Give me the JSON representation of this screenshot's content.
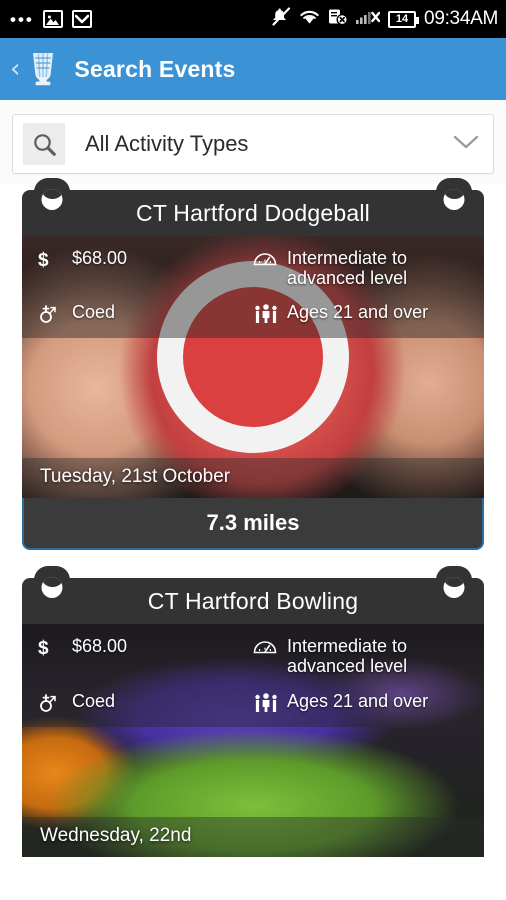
{
  "status_bar": {
    "left_icons": [
      "more-dots-icon",
      "photo-icon",
      "email-icon"
    ],
    "right_icons": [
      "mute-icon",
      "wifi-icon",
      "sim-off-icon",
      "signal-off-icon"
    ],
    "battery_level": "14",
    "time": "09:34AM"
  },
  "app_bar": {
    "back_label": "‹",
    "logo_icon": "trophy-icon",
    "title": "Search Events"
  },
  "filter": {
    "search_icon": "search-icon",
    "value": "All Activity Types",
    "placeholder": "All Activity Types",
    "chevron_icon": "chevron-down-icon"
  },
  "colors": {
    "app_bar": "#3b92d4",
    "card_header": "#333333",
    "footer_bg": "#3b3b3b",
    "footer_border": "#2b6d9e",
    "page_bg": "#ffffff",
    "status_bar": "#000000"
  },
  "cards": [
    {
      "title": "CT Hartford Dodgeball",
      "photo": "kickball-photo",
      "info": [
        {
          "icon": "dollar-icon",
          "text": "$68.00"
        },
        {
          "icon": "gauge-icon",
          "text": "Intermediate to advanced level"
        },
        {
          "icon": "gender-coed-icon",
          "text": "Coed"
        },
        {
          "icon": "people-icon",
          "text": "Ages 21 and over"
        }
      ],
      "date": "Tuesday, 21st October",
      "distance": "7.3 miles"
    },
    {
      "title": "CT Hartford Bowling",
      "photo": "bowling-photo",
      "info": [
        {
          "icon": "dollar-icon",
          "text": "$68.00"
        },
        {
          "icon": "gauge-icon",
          "text": "Intermediate to advanced level"
        },
        {
          "icon": "gender-coed-icon",
          "text": "Coed"
        },
        {
          "icon": "people-icon",
          "text": "Ages 21 and over"
        }
      ],
      "date": "Wednesday, 22nd",
      "distance": ""
    }
  ]
}
